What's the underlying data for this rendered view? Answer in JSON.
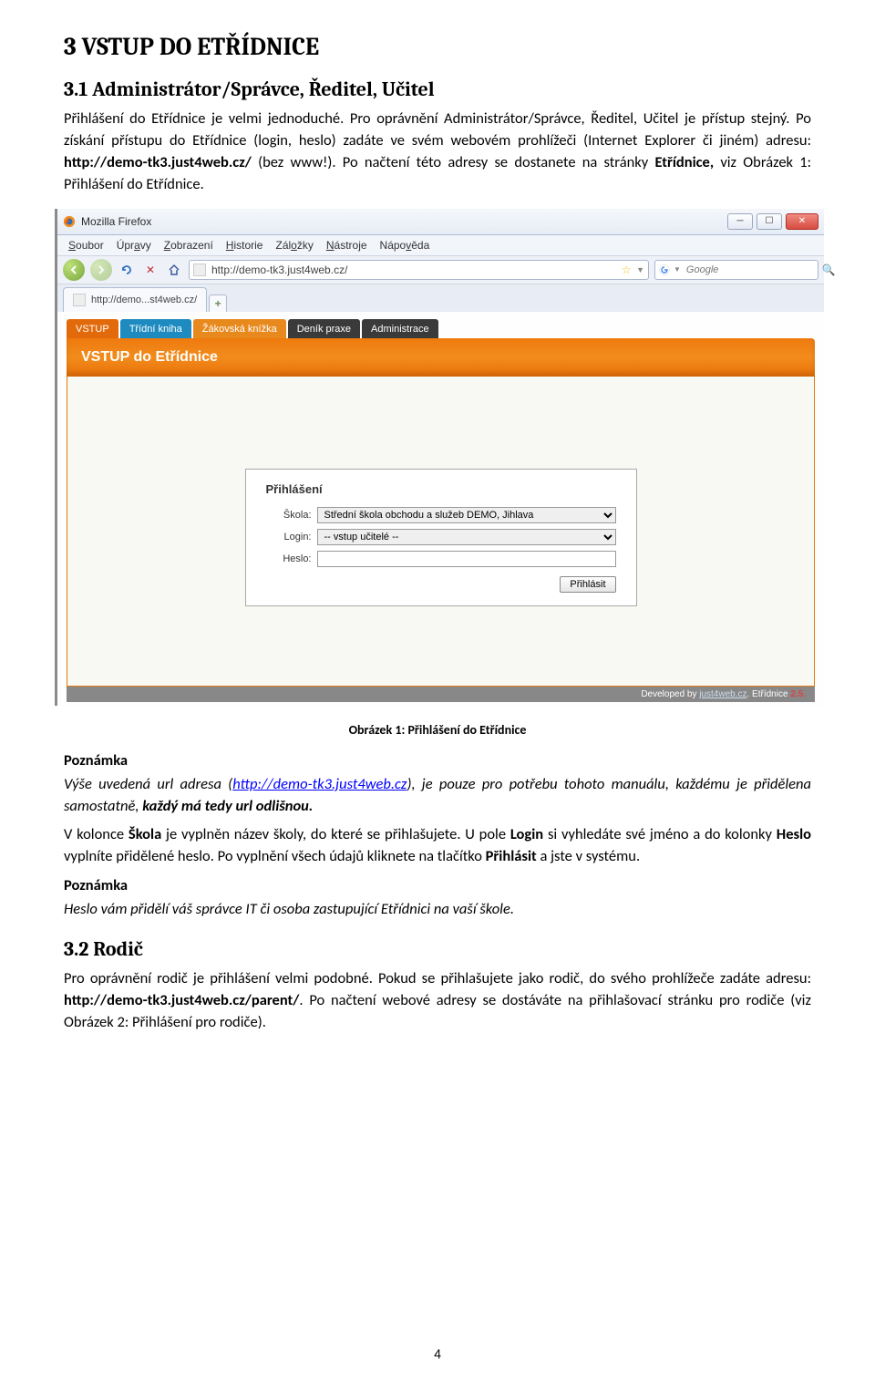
{
  "sections": {
    "h1": "3 VSTUP DO ETŘÍDNICE",
    "h2a": "3.1 Administrátor/Správce, Ředitel, Učitel",
    "p1_1": "Přihlášení do Etřídnice je velmi jednoduché. Pro oprávnění Administrátor/Správce, Ředitel, Učitel je přístup stejný. Po získání přístupu do Etřídnice (login, heslo) zadáte ve svém webovém prohlížeči (Internet Explorer či jiném) adresu: ",
    "p1_bold": "http://demo-tk3.just4web.cz/",
    "p1_2": " (bez www!). Po načtení této adresy se dostanete na stránky ",
    "p1_bold2": "Etřídnice, ",
    "p1_3": "viz Obrázek 1: Přihlášení do Etřídnice.",
    "figcap": "Obrázek 1: Přihlášení do Etřídnice",
    "note_label": "Poznámka",
    "note1_a": "Výše uvedená url adresa (",
    "note1_link": "http://demo-tk3.just4web.cz",
    "note1_b": "), je pouze pro potřebu tohoto manuálu, každému je přidělena samostatně, ",
    "note1_bold": "každý má tedy url odlišnou.",
    "p2_a": "V kolonce ",
    "p2_bold1": "Škola",
    "p2_b": " je vyplněn název školy, do které se přihlašujete. U pole ",
    "p2_bold2": "Login",
    "p2_c": " si vyhledáte své jméno a do kolonky ",
    "p2_bold3": "Heslo",
    "p2_d": " vyplníte přidělené heslo. Po vyplnění všech údajů kliknete na tlačítko ",
    "p2_bold4": "Přihlásit",
    "p2_e": " a jste v systému.",
    "note2": "Heslo vám přidělí váš správce IT či osoba zastupující Etřídnici na vaší škole.",
    "h2b": "3.2 Rodič",
    "p3_a": "Pro oprávnění rodič je přihlášení velmi podobné. Pokud se přihlašujete jako rodič, do svého prohlížeče zadáte adresu: ",
    "p3_bold": "http://demo-tk3.just4web.cz/parent/",
    "p3_b": ". Po načtení webové adresy se dostáváte na přihlašovací stránku pro rodiče (viz Obrázek 2: Přihlášení pro rodiče).",
    "pagenum": "4"
  },
  "browser": {
    "win_title": "Mozilla Firefox",
    "menus": [
      "Soubor",
      "Úpravy",
      "Zobrazení",
      "Historie",
      "Záložky",
      "Nástroje",
      "Nápověda"
    ],
    "url": "http://demo-tk3.just4web.cz/",
    "search_placeholder": "Google",
    "tab_label": "http://demo...st4web.cz/"
  },
  "app": {
    "tabs": [
      {
        "label": "VSTUP",
        "cls": "active"
      },
      {
        "label": "Třídní kniha",
        "cls": ""
      },
      {
        "label": "Žákovská knížka",
        "cls": "orange"
      },
      {
        "label": "Deník praxe",
        "cls": "dark"
      },
      {
        "label": "Administrace",
        "cls": "dark"
      }
    ],
    "header": "VSTUP do Etřídnice",
    "login": {
      "title": "Přihlášení",
      "school_label": "Škola:",
      "school_value": "Střední škola obchodu a služeb DEMO, Jihlava",
      "login_label": "Login:",
      "login_value": "-- vstup učitelé --",
      "password_label": "Heslo:",
      "submit": "Přihlásit"
    },
    "footer_prefix": "Developed by ",
    "footer_link": "just4web.cz",
    "footer_suffix": ". Etřídnice ",
    "footer_version": "2.5."
  }
}
